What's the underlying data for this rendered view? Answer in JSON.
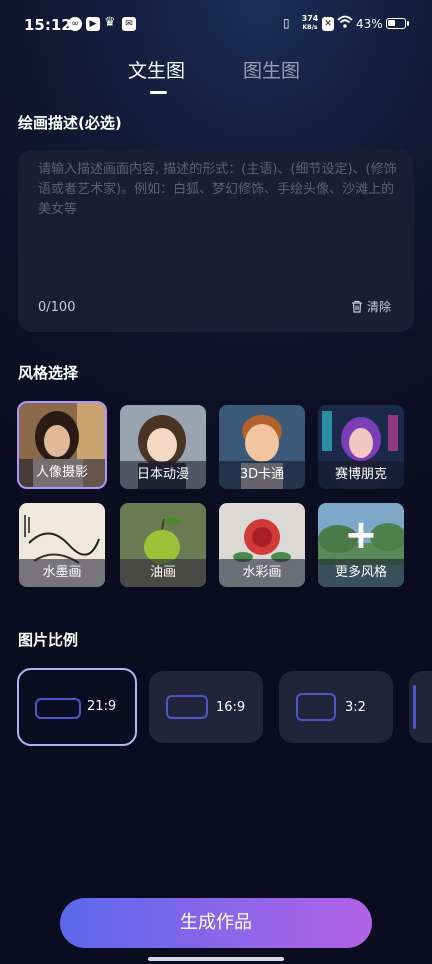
{
  "status_bar": {
    "time": "15:12",
    "network_speed_top": "374",
    "network_speed_unit": "KB/s",
    "battery": "43%",
    "battery_level": 0.43
  },
  "tabs": [
    {
      "label": "文生图",
      "active": true
    },
    {
      "label": "图生图",
      "active": false
    }
  ],
  "prompt": {
    "section_title": "绘画描述(必选)",
    "placeholder": "请输入描述画面内容, 描述的形式：(主语)、(细节设定)、(修饰语或者艺术家)。例如：白狐、梦幻修饰、手绘头像、沙滩上的美女等",
    "value": "",
    "counter": "0/100",
    "clear_label": "清除"
  },
  "styles": {
    "section_title": "风格选择",
    "items": [
      {
        "label": "人像摄影",
        "selected": true
      },
      {
        "label": "日本动漫",
        "selected": false
      },
      {
        "label": "3D卡通",
        "selected": false
      },
      {
        "label": "赛博朋克",
        "selected": false
      },
      {
        "label": "水墨画",
        "selected": false
      },
      {
        "label": "油画",
        "selected": false
      },
      {
        "label": "水彩画",
        "selected": false
      },
      {
        "label": "更多风格",
        "selected": false
      }
    ]
  },
  "ratio": {
    "section_title": "图片比例",
    "items": [
      {
        "label": "21:9",
        "selected": true
      },
      {
        "label": "16:9",
        "selected": false
      },
      {
        "label": "3:2",
        "selected": false
      }
    ]
  },
  "generate_button": "生成作品",
  "colors": {
    "accent": "#a996ff",
    "button_start": "#5a68ea",
    "button_end": "#b262e6",
    "card_bg": "#1c1d33"
  }
}
